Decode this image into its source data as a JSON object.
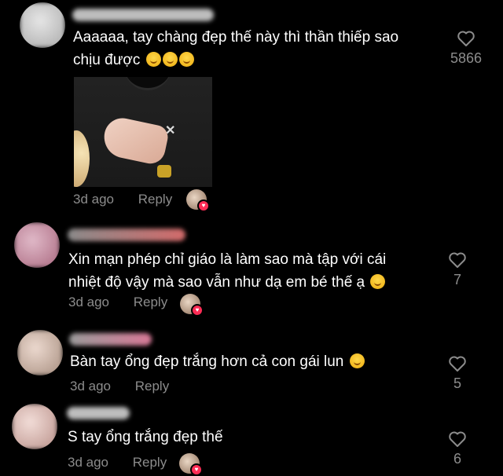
{
  "comments": [
    {
      "text_line1": "Aaaaaa, tay chàng đẹp thế này thì thần thiếp sao",
      "text_line2": "chịu được",
      "time": "3d ago",
      "reply": "Reply",
      "likes": "5866",
      "avatar_color": "#cfcfcf",
      "name_color": "#bdbdbd"
    },
    {
      "text_line1": "Xin mạn phép chỉ giáo là làm sao mà tập với cái",
      "text_line2": "nhiệt độ vậy mà sao vẫn như dạ em bé thế ạ",
      "time": "3d ago",
      "reply": "Reply",
      "likes": "7",
      "avatar_color": "#c98fa6",
      "name_color": "#d26a6a"
    },
    {
      "text_line1": "Bàn tay ổng đẹp trắng hơn cả con gái lun",
      "time": "3d ago",
      "reply": "Reply",
      "likes": "5",
      "avatar_color": "#d8c2b6",
      "name_color": "#d77896"
    },
    {
      "text_line1": "S tay ổng trắng đẹp thế",
      "time": "3d ago",
      "reply": "Reply",
      "likes": "6",
      "avatar_color": "#e2c6c0",
      "name_color": "#bdbdbd"
    }
  ],
  "colors": {
    "background": "#000000",
    "text": "#ffffff",
    "muted": "#8c8c8c",
    "heart_badge": "#fe2c55"
  },
  "icons": {
    "like": "heart-outline-icon",
    "creator_liked": "creator-liked-avatar-icon",
    "emoji": "hand-over-mouth-emoji"
  }
}
